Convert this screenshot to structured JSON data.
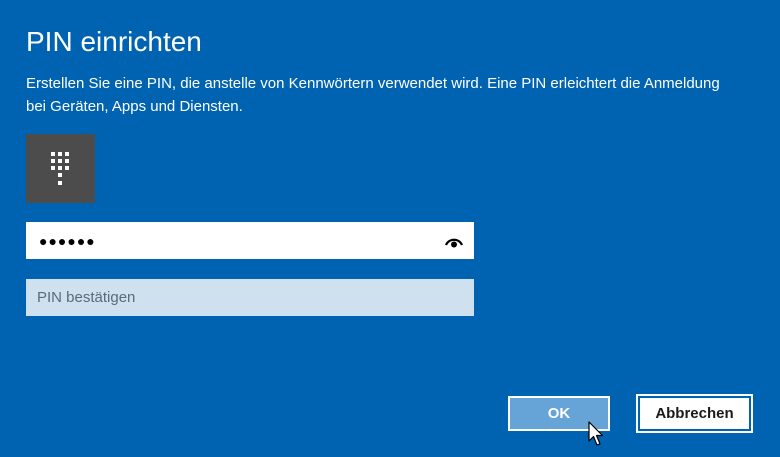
{
  "dialog": {
    "title": "PIN einrichten",
    "description": "Erstellen Sie eine PIN, die anstelle von Kennwörtern verwendet wird. Eine PIN erleichtert die Anmeldung bei Geräten, Apps und Diensten."
  },
  "pin_field": {
    "masked_value": "●●●●●●",
    "reveal_icon": "eye-icon"
  },
  "confirm_field": {
    "placeholder": "PIN bestätigen",
    "value": ""
  },
  "buttons": {
    "ok_label": "OK",
    "cancel_label": "Abbrechen"
  },
  "icons": {
    "keypad": "keypad-icon"
  },
  "colors": {
    "background": "#0063b1",
    "tile": "#4c4c4c",
    "confirm_field_bg": "#cfe1ee",
    "ok_button_bg": "#66a3d6"
  }
}
